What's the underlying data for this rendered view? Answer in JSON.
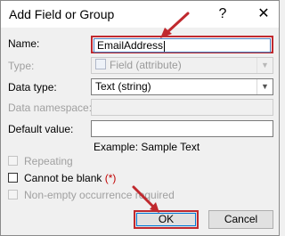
{
  "dialog": {
    "title": "Add Field or Group",
    "help_icon": "question-mark-icon",
    "close_icon": "close-icon"
  },
  "form": {
    "name_label": "Name:",
    "name_value": "EmailAddress",
    "type_label": "Type:",
    "type_value": "Field (attribute)",
    "data_type_label": "Data type:",
    "data_type_value": "Text (string)",
    "data_namespace_label": "Data namespace:",
    "data_namespace_value": "",
    "default_value_label": "Default value:",
    "default_value_value": "",
    "example_text": "Example: Sample Text"
  },
  "options": {
    "repeating": {
      "label": "Repeating",
      "checked": false,
      "enabled": false
    },
    "cannot_be_blank": {
      "label": "Cannot be blank",
      "marker": "(*)",
      "checked": false,
      "enabled": true
    },
    "non_empty_occurrence": {
      "label": "Non-empty occurrence required",
      "checked": false,
      "enabled": false
    }
  },
  "buttons": {
    "ok_label": "OK",
    "cancel_label": "Cancel"
  },
  "colors": {
    "highlight": "#c0292e",
    "focus": "#0078d7",
    "required_marker": "#c00000"
  }
}
